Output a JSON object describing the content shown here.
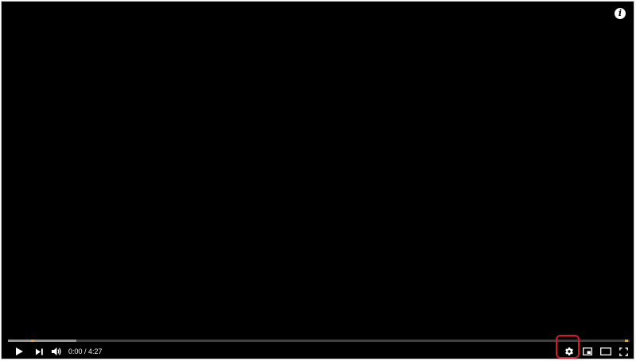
{
  "player": {
    "current_time": "0:00",
    "separator": " / ",
    "duration": "4:27",
    "info_glyph": "i",
    "buffered_fraction": 0.11,
    "marker_fractions": [
      0.04,
      0.995
    ],
    "colors": {
      "background": "#000000",
      "marker": "#f0a030",
      "highlight": "#d9192a",
      "icon": "#ffffff"
    },
    "icons": [
      "play-icon",
      "next-icon",
      "volume-icon",
      "settings-gear-icon",
      "miniplayer-icon",
      "theater-mode-icon",
      "fullscreen-icon",
      "info-icon"
    ]
  }
}
